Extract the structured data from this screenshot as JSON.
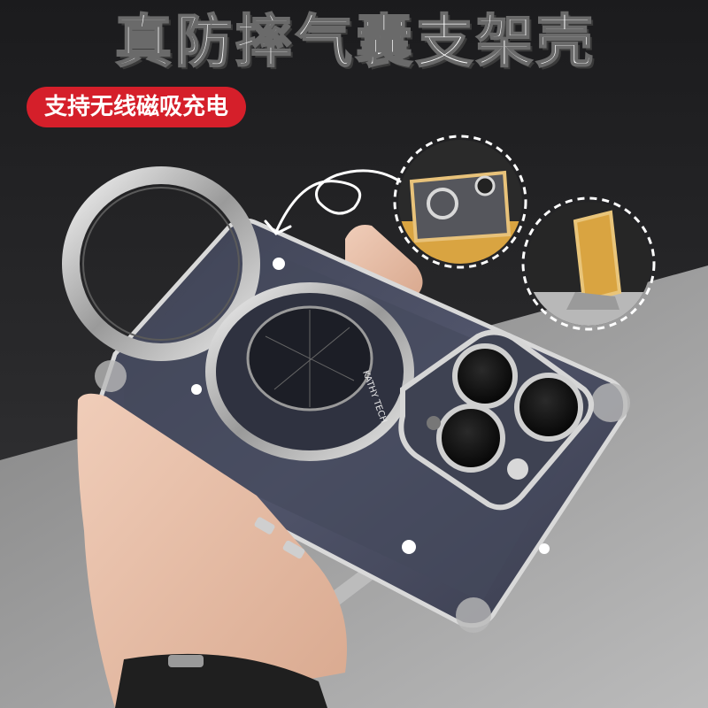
{
  "headline": "真防摔气囊支架壳",
  "badge": "支持无线磁吸充电",
  "lens_text": "KATHY TECH",
  "colors": {
    "badge_red": "#d51f2a",
    "background_dark": "#1a1a1c",
    "floor_gray": "#bdbdbd",
    "chrome": "#c9c9c9",
    "gold_accent": "#d9a441"
  }
}
